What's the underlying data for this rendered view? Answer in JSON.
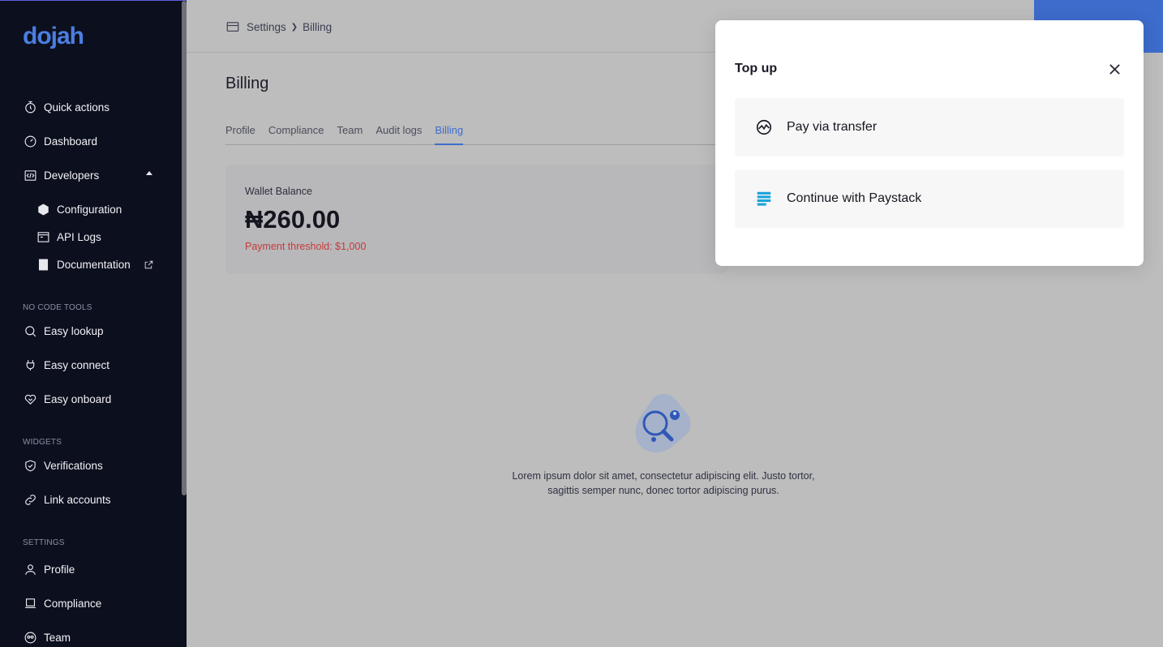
{
  "brand": {
    "logo_text": "dojah",
    "accent": "#3d6ccc"
  },
  "sidebar": {
    "items": [
      {
        "label": "Quick actions",
        "icon": "stopwatch-icon"
      },
      {
        "label": "Dashboard",
        "icon": "dashboard-gauge-icon"
      },
      {
        "label": "Developers",
        "icon": "code-icon"
      }
    ],
    "developer_items": [
      {
        "label": "Configuration",
        "icon": "hexagon-icon"
      },
      {
        "label": "API Logs",
        "icon": "browser-window-icon"
      },
      {
        "label": "Documentation",
        "icon": "book-icon"
      }
    ],
    "no_code_label": "NO CODE TOOLS",
    "no_code_items": [
      {
        "label": "Easy lookup",
        "icon": "search-icon"
      },
      {
        "label": "Easy connect",
        "icon": "plug-icon"
      },
      {
        "label": "Easy onboard",
        "icon": "heart-handshake-icon"
      }
    ],
    "widgets_label": "WIDGETS",
    "widgets_items": [
      {
        "label": "Verifications",
        "icon": "shield-check-icon"
      },
      {
        "label": "Link accounts",
        "icon": "link-icon"
      }
    ],
    "settings_label": "SETTINGS",
    "settings_items": [
      {
        "label": "Profile",
        "icon": "user-icon"
      },
      {
        "label": "Compliance",
        "icon": "laptop-icon"
      },
      {
        "label": "Team",
        "icon": "team-icon"
      }
    ]
  },
  "breadcrumb": {
    "first": "Settings",
    "second": "Billing"
  },
  "page": {
    "title": "Billing",
    "tabs": [
      "Profile",
      "Compliance",
      "Team",
      "Audit logs",
      "Billing"
    ],
    "active_tab": "Billing"
  },
  "wallet": {
    "label": "Wallet Balance",
    "amount": "₦260.00",
    "threshold": "Payment threshold: $1,000"
  },
  "empty_state": {
    "text": "Lorem ipsum dolor sit amet, consectetur adipiscing elit. Justo tortor, sagittis semper nunc, donec tortor adipiscing purus."
  },
  "modal": {
    "title": "Top up",
    "options": [
      {
        "label": "Pay via transfer",
        "icon": "transfer-chart-icon"
      },
      {
        "label": "Continue with Paystack",
        "icon": "paystack-logo-icon"
      }
    ]
  }
}
